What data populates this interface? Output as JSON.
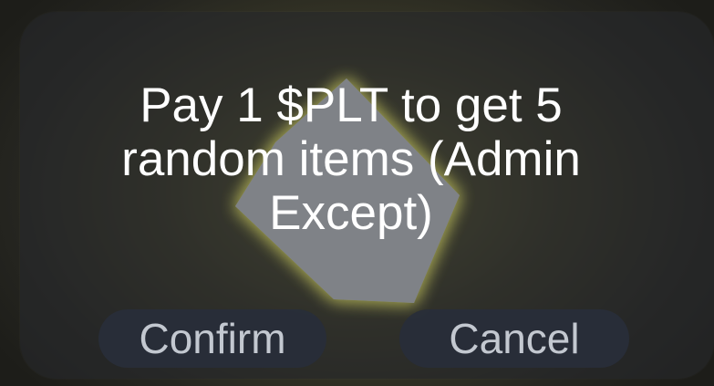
{
  "dialog": {
    "message": "Pay 1 $PLT to get 5 random items (Admin Except)",
    "confirm_label": "Confirm",
    "cancel_label": "Cancel"
  },
  "colors": {
    "glow": "#e8e86a",
    "box": "#7f8287",
    "button_bg": "#282e3a",
    "button_text": "#c3c8d0",
    "message_text": "#ffffff"
  }
}
